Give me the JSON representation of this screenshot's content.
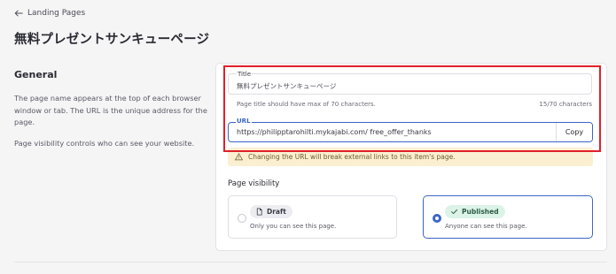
{
  "breadcrumb": {
    "back_label": "Landing Pages"
  },
  "page": {
    "title": "無料プレゼントサンキューページ"
  },
  "general": {
    "heading": "General",
    "description": "The page name appears at the top of each browser window or tab. The URL is the unique address for the page.",
    "visibility_note": "Page visibility controls who can see your website."
  },
  "form": {
    "title_label": "Title",
    "title_value": "無料プレゼントサンキューページ",
    "title_hint": "Page title should have max of 70 characters.",
    "title_counter": "15/70 characters",
    "url_label": "URL",
    "url_value": "https://philipptarohilti.mykajabi.com/ free_offer_thanks",
    "copy_label": "Copy",
    "warning": "Changing the URL will break external links to this item's page."
  },
  "visibility": {
    "heading": "Page visibility",
    "options": [
      {
        "label": "Draft",
        "description": "Only you can see this page.",
        "selected": false
      },
      {
        "label": "Published",
        "description": "Anyone can see this page.",
        "selected": true
      }
    ]
  },
  "colors": {
    "accent": "#3b66c4",
    "warning_bg": "#fbefd2",
    "published_badge_bg": "#dcf3e8",
    "highlight": "#e0202a"
  }
}
